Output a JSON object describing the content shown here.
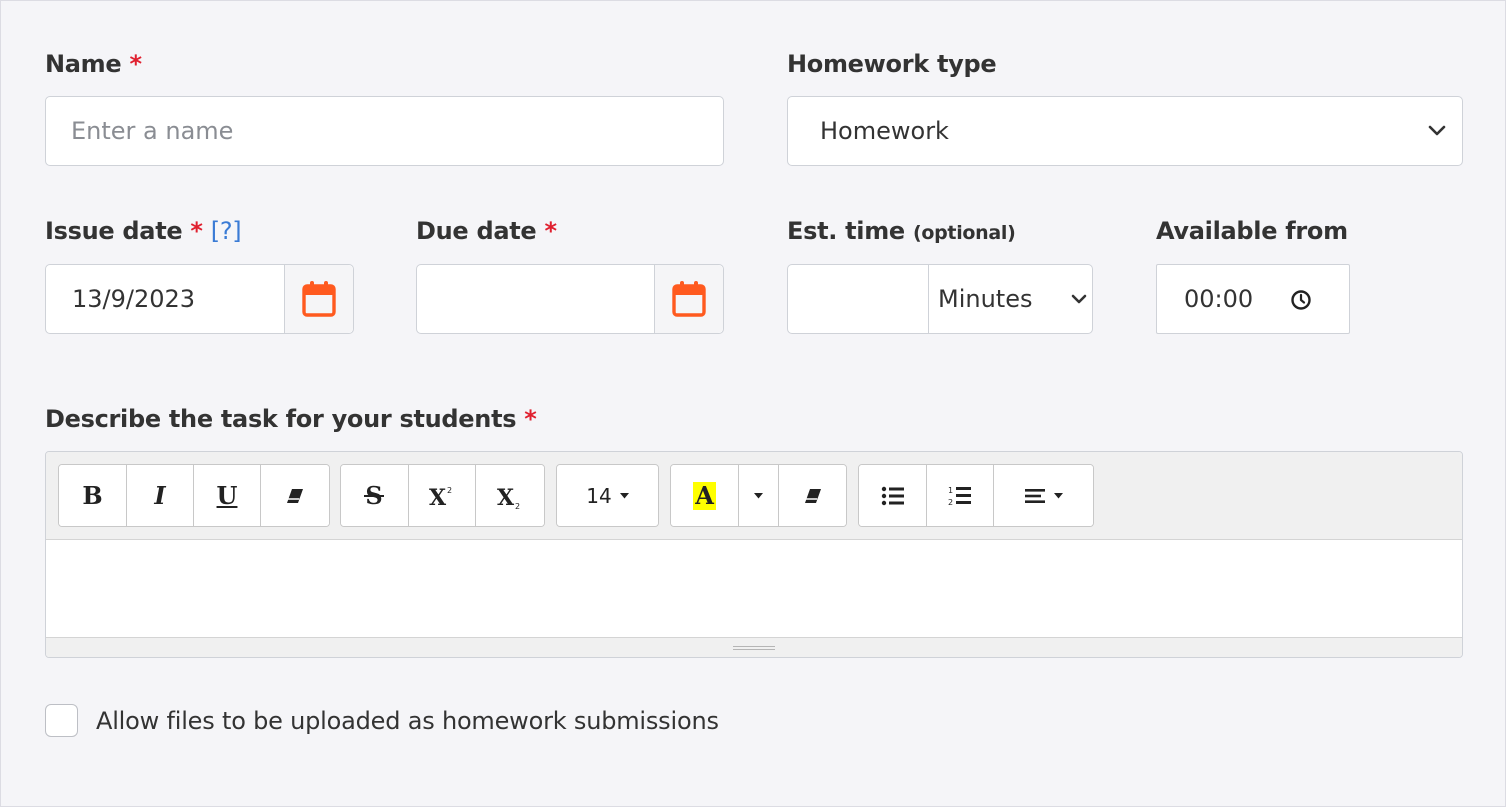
{
  "form": {
    "name": {
      "label": "Name",
      "required_mark": "*",
      "placeholder": "Enter a name",
      "value": ""
    },
    "homework_type": {
      "label": "Homework type",
      "selected": "Homework"
    },
    "issue_date": {
      "label": "Issue date",
      "required_mark": "*",
      "help": "[?]",
      "value": "13/9/2023",
      "icon": "calendar-icon"
    },
    "due_date": {
      "label": "Due date",
      "required_mark": "*",
      "value": "",
      "icon": "calendar-icon"
    },
    "est_time": {
      "label": "Est. time",
      "optional": "(optional)",
      "value": "",
      "unit": "Minutes"
    },
    "available_from": {
      "label": "Available from",
      "value": "00:00",
      "icon": "clock-icon"
    },
    "description": {
      "label": "Describe the task for your students",
      "required_mark": "*",
      "toolbar": {
        "bold": "B",
        "italic": "I",
        "underline": "U",
        "font_size": "14",
        "highlight": "A"
      },
      "content": ""
    },
    "allow_uploads": {
      "label": "Allow files to be uploaded as homework submissions",
      "checked": false
    }
  },
  "colors": {
    "accent": "#ff5a1f",
    "required": "#e0202f",
    "help_link": "#3a7bd5",
    "highlight": "#ffff00"
  }
}
